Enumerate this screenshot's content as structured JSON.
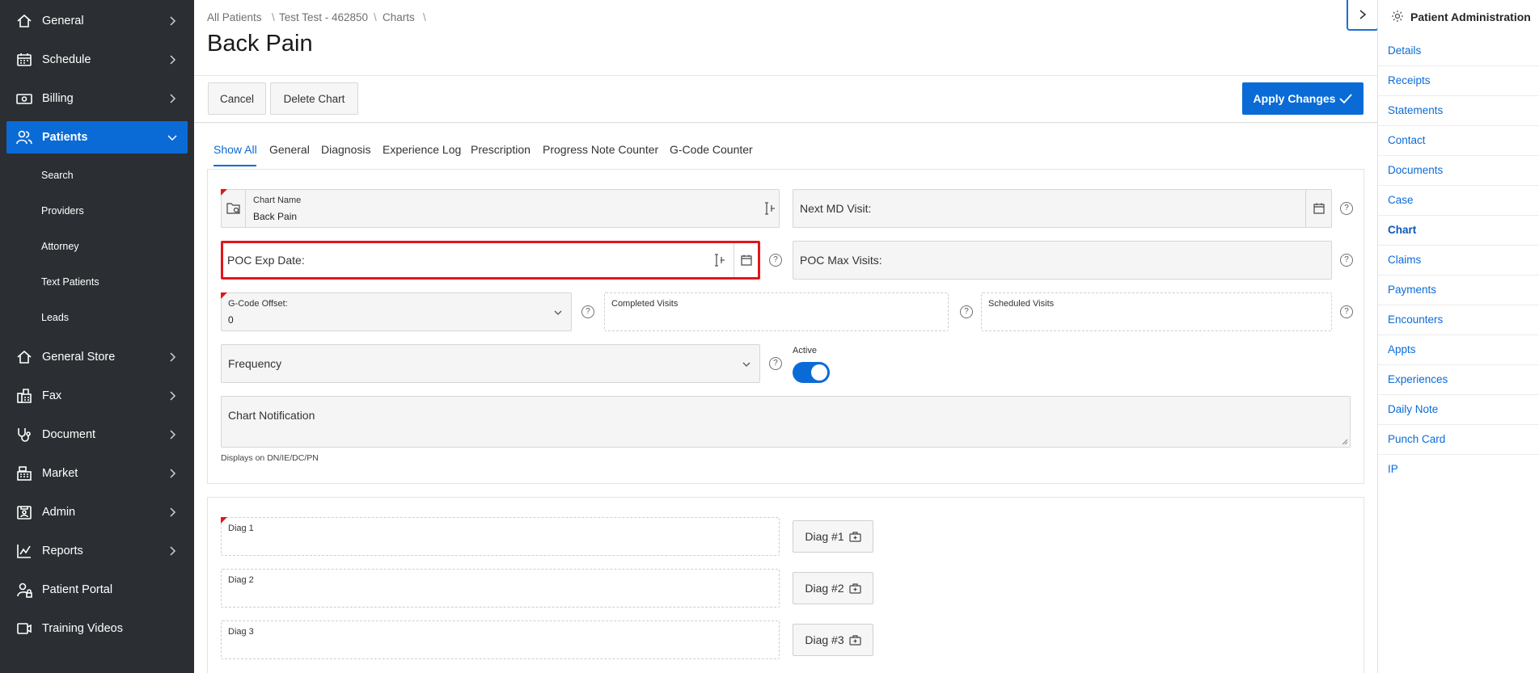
{
  "sidebar": {
    "items": [
      {
        "label": "General",
        "icon": "home-icon"
      },
      {
        "label": "Schedule",
        "icon": "calendar-icon"
      },
      {
        "label": "Billing",
        "icon": "money-icon"
      },
      {
        "label": "Patients",
        "icon": "users-icon"
      },
      {
        "label": "General Store",
        "icon": "home-icon"
      },
      {
        "label": "Fax",
        "icon": "fax-icon"
      },
      {
        "label": "Document",
        "icon": "stethoscope-icon"
      },
      {
        "label": "Market",
        "icon": "cash-register-icon"
      },
      {
        "label": "Admin",
        "icon": "id-card-icon"
      },
      {
        "label": "Reports",
        "icon": "line-chart-icon"
      },
      {
        "label": "Patient Portal",
        "icon": "user-lock-icon"
      },
      {
        "label": "Training Videos",
        "icon": "video-icon"
      }
    ],
    "patients_sub": [
      "Search",
      "Providers",
      "Attorney",
      "Text Patients",
      "Leads"
    ]
  },
  "breadcrumb": [
    "All Patients",
    "Test Test - 462850",
    "Charts"
  ],
  "page_title": "Back Pain",
  "toolbar": {
    "cancel_label": "Cancel",
    "delete_label": "Delete Chart",
    "apply_label": "Apply Changes"
  },
  "tabs": [
    "Show All",
    "General",
    "Diagnosis",
    "Experience Log",
    "Prescription",
    "Progress Note Counter",
    "G-Code Counter"
  ],
  "form": {
    "chart_name_label": "Chart Name",
    "chart_name_value": "Back Pain",
    "next_md_visit_label": "Next MD Visit:",
    "poc_exp_date_label": "POC Exp Date:",
    "poc_max_visits_label": "POC Max Visits:",
    "gcode_offset_label": "G-Code Offset:",
    "gcode_offset_value": "0",
    "completed_visits_label": "Completed Visits",
    "scheduled_visits_label": "Scheduled Visits",
    "frequency_label": "Frequency",
    "active_label": "Active",
    "active_value": true,
    "chart_notification_label": "Chart Notification",
    "chart_notification_hint": "Displays on DN/IE/DC/PN",
    "help_glyph": "?"
  },
  "diagnosis": [
    {
      "label": "Diag 1",
      "button": "Diag #1"
    },
    {
      "label": "Diag 2",
      "button": "Diag #2"
    },
    {
      "label": "Diag 3",
      "button": "Diag #3"
    }
  ],
  "right_panel": {
    "title": "Patient Administration",
    "items": [
      "Details",
      "Receipts",
      "Statements",
      "Contact",
      "Documents",
      "Case",
      "Chart",
      "Claims",
      "Payments",
      "Encounters",
      "Appts",
      "Experiences",
      "Daily Note",
      "Punch Card",
      "IP"
    ],
    "active": "Chart"
  },
  "colors": {
    "sidebar_bg": "#2b2f33",
    "accent": "#0b6bd6",
    "highlight_border": "#e0161b"
  }
}
